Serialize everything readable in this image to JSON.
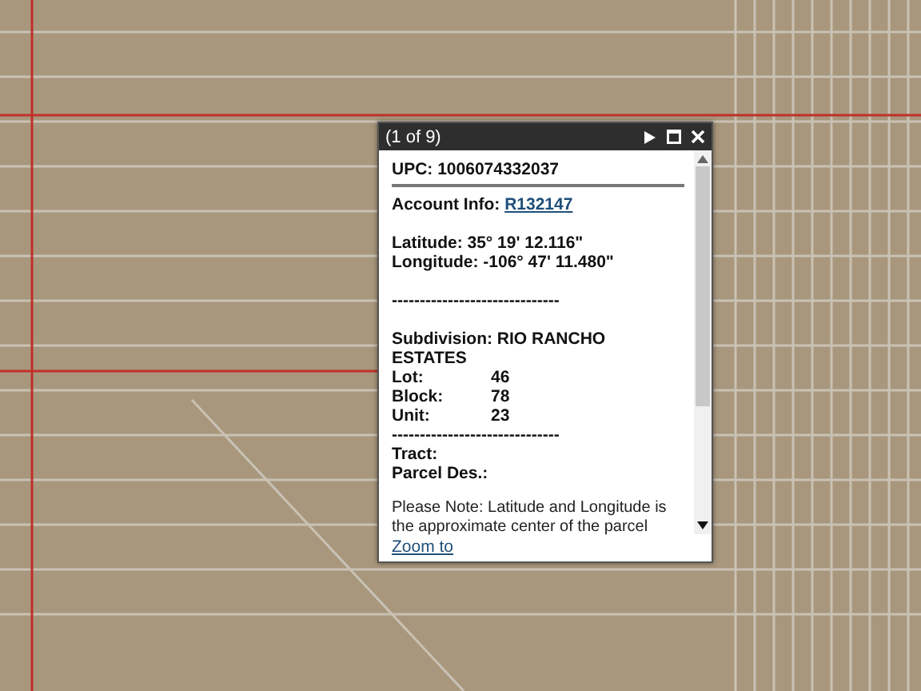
{
  "popup": {
    "title": "(1 of 9)",
    "upc": "UPC: 1006074332037",
    "account_label": "Account Info:",
    "account_link": "R132147",
    "latitude": "Latitude: 35° 19' 12.116\"",
    "longitude": "Longitude: -106° 47' 11.480\"",
    "separator_1": "------------------------------",
    "subdivision": "Subdivision: RIO RANCHO ESTATES",
    "fields": [
      {
        "label": "Lot:",
        "value": "46"
      },
      {
        "label": "Block:",
        "value": "78"
      },
      {
        "label": "Unit:",
        "value": "23"
      }
    ],
    "separator_2": "------------------------------",
    "tract": "Tract:",
    "parcel": "Parcel Des.:",
    "note": "Please Note: Latitude and Longitude is the approximate center of the parcel",
    "zoom_link": "Zoom to"
  }
}
